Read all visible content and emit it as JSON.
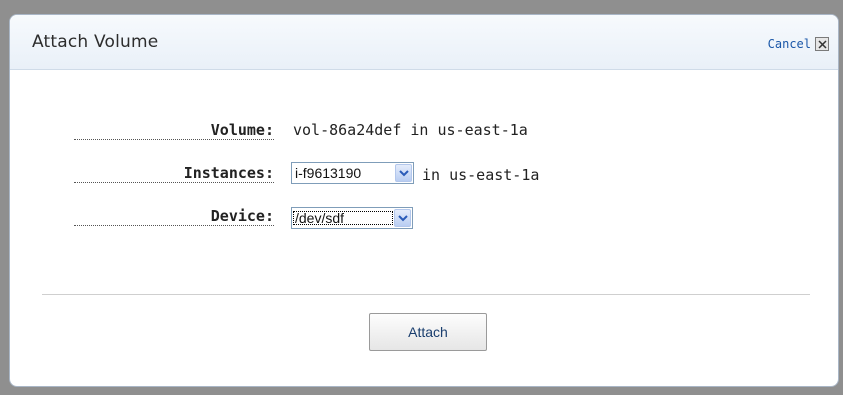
{
  "dialog": {
    "title": "Attach Volume",
    "cancel_label": "Cancel",
    "close_glyph": "✕"
  },
  "form": {
    "volume": {
      "label": "Volume:",
      "value": "vol-86a24def in us-east-1a"
    },
    "instances": {
      "label": "Instances:",
      "selected": "i-f9613190",
      "suffix": "in us-east-1a"
    },
    "device": {
      "label": "Device:",
      "selected": "/dev/sdf"
    }
  },
  "actions": {
    "attach_label": "Attach"
  },
  "icons": {
    "close": "close-icon",
    "dropdown": "chevron-down-icon"
  },
  "colors": {
    "link": "#1a57a8",
    "header_bg": "#e9f0f8",
    "border": "#a9b6c6",
    "dropdown_accent": "#2a5bb8"
  }
}
